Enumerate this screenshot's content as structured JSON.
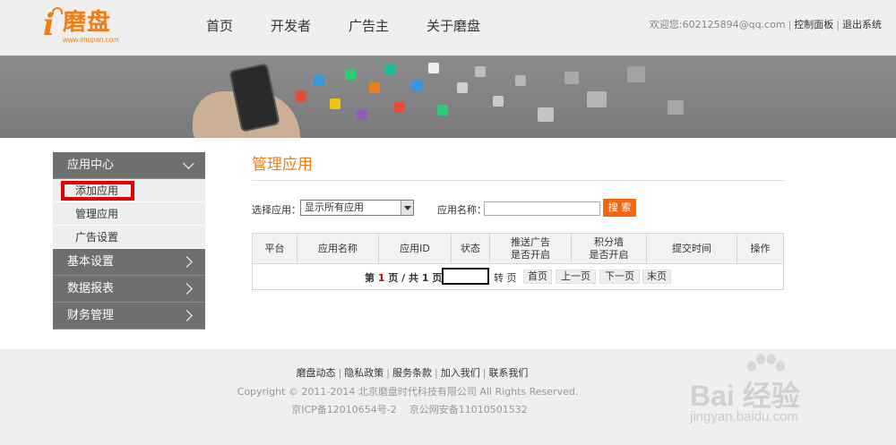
{
  "header": {
    "logo_text": "磨盘",
    "logo_url": "www.imopan.com",
    "nav": [
      "首页",
      "开发者",
      "广告主",
      "关于磨盘"
    ],
    "welcome": "欢迎您:602125894@qq.com",
    "control_panel": "控制面板",
    "logout": "退出系统"
  },
  "sidebar": {
    "sections": [
      {
        "label": "应用中心",
        "expanded": true,
        "items": [
          "添加应用",
          "管理应用",
          "广告设置"
        ]
      },
      {
        "label": "基本设置",
        "expanded": false
      },
      {
        "label": "数据报表",
        "expanded": false
      },
      {
        "label": "财务管理",
        "expanded": false
      }
    ]
  },
  "main": {
    "title": "管理应用",
    "filter": {
      "select_label": "选择应用：",
      "select_value": "显示所有应用",
      "name_label": "应用名称：",
      "name_value": "",
      "search_button": "搜 索"
    },
    "table": {
      "columns": [
        "平台",
        "应用名称",
        "应用ID",
        "状态",
        "推送广告\n是否开启",
        "积分墙\n是否开启",
        "提交时间",
        "操作"
      ]
    },
    "pager": {
      "prefix": "第",
      "current": "1",
      "middle": "页 / 共",
      "total": "1",
      "suffix": "页",
      "goto": "转 页",
      "first": "首页",
      "prev": "上一页",
      "next": "下一页",
      "last": "末页"
    }
  },
  "footer": {
    "links": [
      "磨盘动态",
      "隐私政策",
      "服务条款",
      "加入我们",
      "联系我们"
    ],
    "copyright": "Copyright © 2011-2014 北京磨盘时代科技有限公司 All Rights Reserved.",
    "icp": "京ICP备12010654号-2    京公网安备11010501532"
  },
  "watermark": {
    "text": "Bai 经验",
    "url": "jingyan.baidu.com"
  },
  "colors": {
    "accent": "#f07e16",
    "search_button": "#f5670f",
    "sidebar_dark": "#6f6f6f",
    "highlight": "#e00000"
  }
}
